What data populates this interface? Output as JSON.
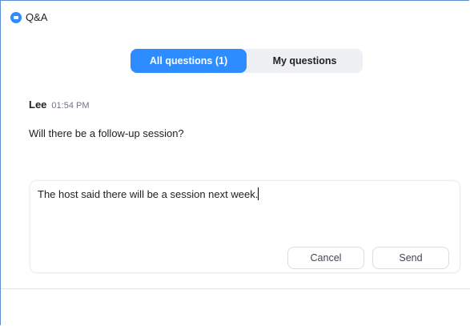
{
  "window": {
    "title": "Q&A",
    "icon": "zoom-app-icon"
  },
  "tabs": [
    {
      "label": "All questions (1)",
      "active": true
    },
    {
      "label": "My questions",
      "active": false
    }
  ],
  "question": {
    "author": "Lee",
    "time": "01:54 PM",
    "text": "Will there be a follow-up session?"
  },
  "answer": {
    "value": "The host said there will be a session next week.",
    "cancel_label": "Cancel",
    "send_label": "Send"
  },
  "colors": {
    "accent": "#2d8cff",
    "window_border": "#5b8fd6"
  }
}
